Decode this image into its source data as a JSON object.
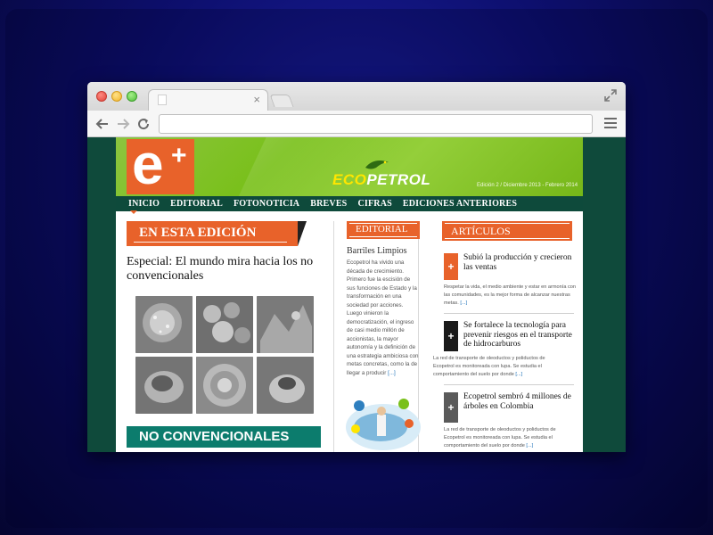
{
  "browser": {
    "tab_close": "×",
    "url": ""
  },
  "site": {
    "logo_letter": "e",
    "logo_plus": "+",
    "brand_eco": "ECO",
    "brand_petrol": "PETROL",
    "edition_info": "Edición 2 / Diciembre 2013 - Febrero 2014",
    "nav": [
      "INICIO",
      "EDITORIAL",
      "FOTONOTICIA",
      "BREVES",
      "CIFRAS",
      "EDICIONES ANTERIORES"
    ],
    "colors": {
      "brand_green": "#79c01a",
      "nav_green": "#0e4a3b",
      "orange": "#e8622a",
      "teal": "#0c7c6d"
    }
  },
  "left": {
    "banner": "EN ESTA EDICIÓN",
    "feature_title": "Especial: El mundo mira hacia los no convencionales",
    "nc_banner": "NO CONVENCIONALES"
  },
  "editorial": {
    "label": "EDITORIAL",
    "title": "Barriles Limpios",
    "body": "Ecopetrol ha vivido una década de crecimiento. Primero fue la escisión de sus funciones de Estado y la transformación en una sociedad por acciones. Luego vinieron la democratización, el ingreso de casi medio millón de accionistas, la mayor autonomía y la definición de una estrategia ambiciosa con metas concretas, como la de llegar a producir",
    "more": "[...]"
  },
  "articles": {
    "label": "ARTÍCULOS",
    "items": [
      {
        "plus": "+",
        "color": "#e8622a",
        "title": "Subió la producción y crecieron las ventas",
        "body": "Respetar la vida, el medio ambiente y estar en armonía con las comunidades, es la mejor forma de alcanzar nuestras metas.",
        "more": "[...]"
      },
      {
        "plus": "+",
        "color": "#1a1a1a",
        "title": "Se fortalece la tecnología para prevenir riesgos en el transporte de hidrocarburos",
        "body": "La red de transporte de oleoductos y poliductos de Ecopetrol es monitoreada con lupa. Se estudia el comportamiento del suelo por donde",
        "more": "[...]"
      },
      {
        "plus": "+",
        "color": "#5a5a5a",
        "title": "Ecopetrol sembró 4 millones de árboles en Colombia",
        "body": "La red de transporte de oleoductos y poliductos de Ecopetrol es monitoreada con lupa. Se estudia el comportamiento del suelo por donde",
        "more": "[...]"
      }
    ]
  }
}
